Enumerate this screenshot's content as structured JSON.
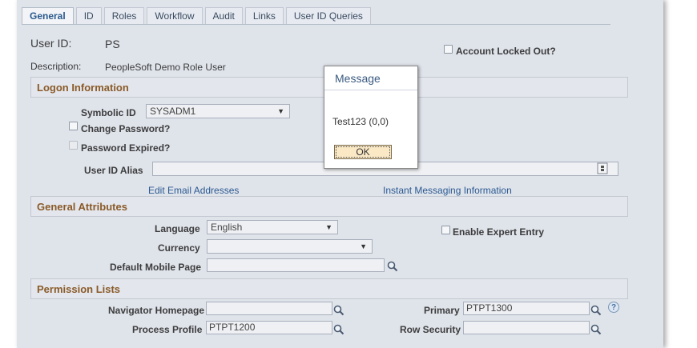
{
  "tabs": [
    "General",
    "ID",
    "Roles",
    "Workflow",
    "Audit",
    "Links",
    "User ID Queries"
  ],
  "header": {
    "user_id_label": "User ID:",
    "user_id_value": "PS",
    "description_label": "Description:",
    "description_value": "PeopleSoft Demo Role User",
    "account_locked_label": "Account Locked Out?"
  },
  "logon": {
    "section_title": "Logon Information",
    "symbolic_id_label": "Symbolic ID",
    "symbolic_id_value": "SYSADM1",
    "change_password_label": "Change Password?",
    "password_expired_label": "Password Expired?",
    "user_id_alias_label": "User ID Alias",
    "user_id_alias_value": "",
    "edit_email_link": "Edit Email Addresses",
    "instant_messaging_link": "Instant Messaging Information"
  },
  "general": {
    "section_title": "General Attributes",
    "language_label": "Language",
    "language_value": "English",
    "currency_label": "Currency",
    "currency_value": "",
    "default_mobile_label": "Default Mobile Page",
    "default_mobile_value": "",
    "expert_entry_label": "Enable Expert Entry"
  },
  "permissions": {
    "section_title": "Permission Lists",
    "navigator_label": "Navigator Homepage",
    "navigator_value": "",
    "process_profile_label": "Process Profile",
    "process_profile_value": "PTPT1200",
    "primary_label": "Primary",
    "primary_value": "PTPT1300",
    "row_security_label": "Row Security",
    "row_security_value": ""
  },
  "dialog": {
    "title": "Message",
    "text": "Test123 (0,0)",
    "ok_label": "OK"
  }
}
